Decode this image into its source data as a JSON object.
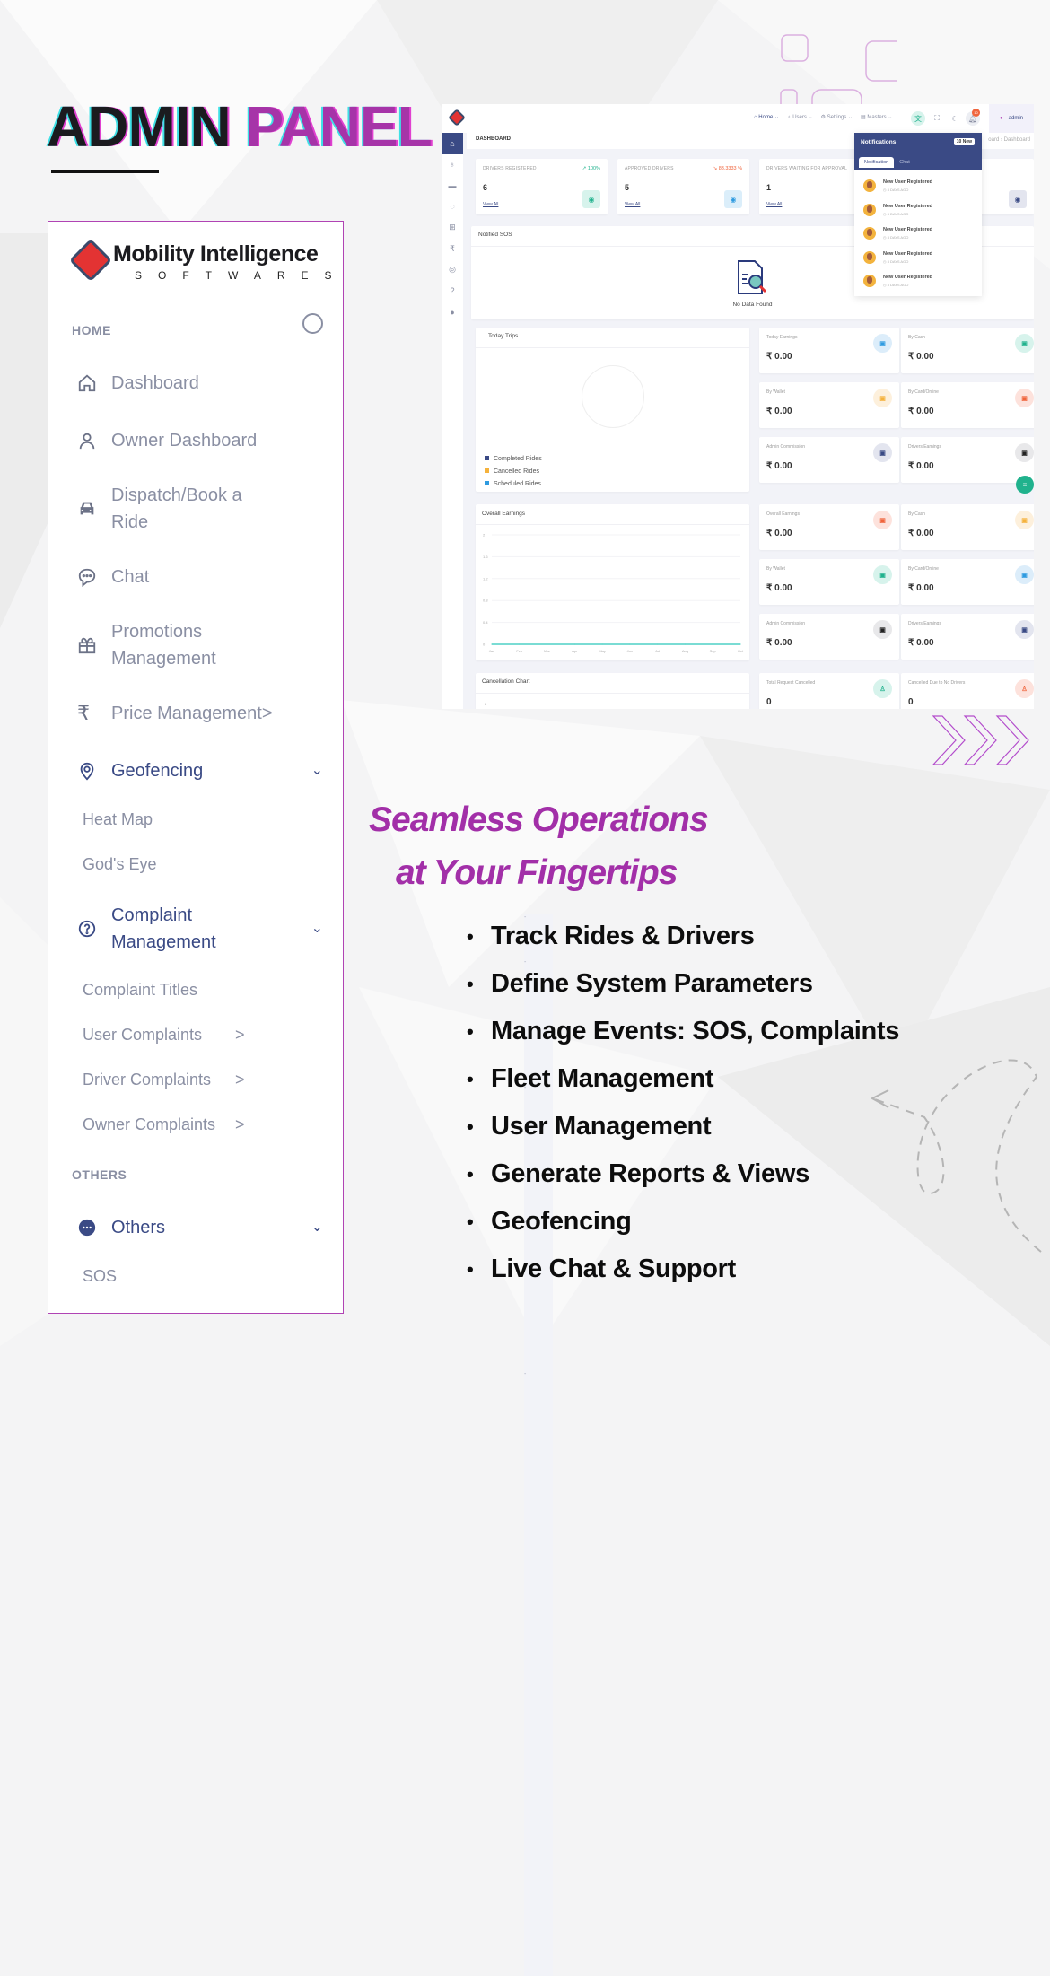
{
  "headline": {
    "word1": "ADMIN",
    "word2": "PANEL"
  },
  "brand": {
    "name": "Mobility Intelligence",
    "sub": "SOFTWARES",
    "logo_icon": "handshake-diamond-icon"
  },
  "sidebar": {
    "sections": {
      "home": "HOME",
      "others": "OTHERS"
    },
    "items": [
      {
        "label": "Dashboard",
        "icon": "home-icon"
      },
      {
        "label": "Owner Dashboard",
        "icon": "user-icon"
      },
      {
        "label": "Dispatch/Book a Ride",
        "icon": "car-icon"
      },
      {
        "label": "Chat",
        "icon": "chat-bubble-icon"
      },
      {
        "label": "Promotions Management",
        "icon": "gift-icon"
      },
      {
        "label": "Price Management",
        "icon": "rupee-icon",
        "arrow": ">"
      },
      {
        "label": "Geofencing",
        "icon": "location-pin-icon",
        "chevron": "⌄"
      },
      {
        "label": "Complaint Management",
        "icon": "question-circle-icon",
        "chevron": "⌄"
      },
      {
        "label": "Others",
        "icon": "more-dots-icon",
        "chevron": "⌄"
      }
    ],
    "geofencing_sub": [
      {
        "label": "Heat Map"
      },
      {
        "label": "God's Eye"
      }
    ],
    "complaint_sub": [
      {
        "label": "Complaint Titles",
        "arrow": ""
      },
      {
        "label": "User Complaints",
        "arrow": ">"
      },
      {
        "label": "Driver Complaints",
        "arrow": ">"
      },
      {
        "label": "Owner Complaints",
        "arrow": ">"
      }
    ],
    "others_sub": [
      {
        "label": "SOS"
      }
    ],
    "dash": "-"
  },
  "dashboard": {
    "topnav": [
      {
        "label": "Home",
        "icon": "home-icon",
        "caret": "⌄"
      },
      {
        "label": "Users",
        "icon": "user-icon",
        "caret": "⌄"
      },
      {
        "label": "Settings",
        "icon": "gear-icon",
        "caret": "⌄"
      },
      {
        "label": "Masters",
        "icon": "document-icon",
        "caret": "⌄"
      }
    ],
    "notif_count": "10",
    "user": "admin",
    "page_title": "DASHBOARD",
    "breadcrumb": "oard › Dashboard",
    "stats": [
      {
        "title": "DRIVERS REGISTERED",
        "pct": "↗ 100%",
        "pct_color": "#20b28d",
        "value": "6",
        "link": "View All",
        "icon_bg": "#d7f3ec",
        "icon_color": "#20b28d"
      },
      {
        "title": "APPROVED DRIVERS",
        "pct": "↘ 83.3333 %",
        "pct_color": "#f0643c",
        "value": "5",
        "link": "View All",
        "icon_bg": "#dbeefa",
        "icon_color": "#2f9be0"
      },
      {
        "title": "DRIVERS WAITING FOR APPROVAL",
        "pct": "",
        "pct_color": "#999",
        "value": "1",
        "link": "View All",
        "icon_bg": "#e3e5ef",
        "icon_color": "#3a4a85"
      }
    ],
    "sos": {
      "title": "Notified SOS",
      "empty": "No Data Found"
    },
    "today_trips": {
      "title": "Today Trips",
      "legend": [
        {
          "label": "Completed Rides",
          "color": "#3a4a85"
        },
        {
          "label": "Cancelled Rides",
          "color": "#f5b23c"
        },
        {
          "label": "Scheduled Rides",
          "color": "#2f9be0"
        }
      ]
    },
    "today_earnings": [
      {
        "title": "Today Earnings",
        "value": "₹ 0.00",
        "bg": "#dcedfa",
        "fg": "#2f9be0"
      },
      {
        "title": "By Cash",
        "value": "₹ 0.00",
        "bg": "#d7f3ec",
        "fg": "#20b28d"
      },
      {
        "title": "By Wallet",
        "value": "₹ 0.00",
        "bg": "#fdf0dc",
        "fg": "#f5b23c"
      },
      {
        "title": "By Card/Online",
        "value": "₹ 0.00",
        "bg": "#fde2dc",
        "fg": "#f0643c"
      },
      {
        "title": "Admin Commission",
        "value": "₹ 0.00",
        "bg": "#e3e5ef",
        "fg": "#3a4a85"
      },
      {
        "title": "Drivers Earnings",
        "value": "₹ 0.00",
        "bg": "#e8e8ea",
        "fg": "#222222"
      }
    ],
    "overall_earnings": [
      {
        "title": "Overall Earnings",
        "value": "₹ 0.00",
        "bg": "#fde2dc",
        "fg": "#f0643c"
      },
      {
        "title": "By Cash",
        "value": "₹ 0.00",
        "bg": "#fdf0dc",
        "fg": "#f5b23c"
      },
      {
        "title": "By Wallet",
        "value": "₹ 0.00",
        "bg": "#d7f3ec",
        "fg": "#20b28d"
      },
      {
        "title": "By Card/Online",
        "value": "₹ 0.00",
        "bg": "#dcedfa",
        "fg": "#2f9be0"
      },
      {
        "title": "Admin Commission",
        "value": "₹ 0.00",
        "bg": "#e8e8ea",
        "fg": "#222222"
      },
      {
        "title": "Drivers Earnings",
        "value": "₹ 0.00",
        "bg": "#e3e5ef",
        "fg": "#3a4a85"
      }
    ],
    "cancel_stats": [
      {
        "title": "Total Request Cancelled",
        "value": "0",
        "bg": "#d7f3ec",
        "fg": "#20b28d"
      },
      {
        "title": "Cancelled Due to No Drivers",
        "value": "0",
        "bg": "#fde2dc",
        "fg": "#f0643c"
      }
    ],
    "cancellation_chart_title": "Cancellation Chart",
    "cancellation_first_tick": "2",
    "notifications": {
      "title": "Notifications",
      "badge": "10 New",
      "tabs": [
        "Notification",
        "Chat"
      ],
      "items": [
        {
          "text": "New User Registered",
          "time": "◷ 3 DAYS AGO"
        },
        {
          "text": "New User Registered",
          "time": "◷ 3 DAYS AGO"
        },
        {
          "text": "New User Registered",
          "time": "◷ 3 DAYS AGO"
        },
        {
          "text": "New User Registered",
          "time": "◷ 3 DAYS AGO"
        },
        {
          "text": "New User Registered",
          "time": "◷ 3 DAYS AGO"
        }
      ]
    }
  },
  "chart_data": {
    "type": "line",
    "title": "Overall Earnings",
    "categories": [
      "Jan",
      "Feb",
      "Mar",
      "Apr",
      "May",
      "Jun",
      "Jul",
      "Aug",
      "Sep",
      "Oct"
    ],
    "series": [
      {
        "name": "Earnings",
        "values": [
          0,
          0,
          0,
          0,
          0,
          0,
          0,
          0,
          0,
          0
        ],
        "color": "#4fd1c5"
      }
    ],
    "yticks": [
      "0",
      "0.4",
      "0.8",
      "1.2",
      "1.6",
      "2"
    ],
    "ylim": [
      0,
      2
    ],
    "grid": true,
    "xlabel": "",
    "ylabel": ""
  },
  "tagline": {
    "line1": "Seamless Operations",
    "line2": "at Your Fingertips"
  },
  "features": [
    "Track Rides & Drivers",
    "Define System Parameters",
    "Manage Events: SOS, Complaints",
    "Fleet Management",
    "User Management",
    "Generate Reports & Views",
    "Geofencing",
    "Live Chat & Support"
  ],
  "bullet": "•"
}
